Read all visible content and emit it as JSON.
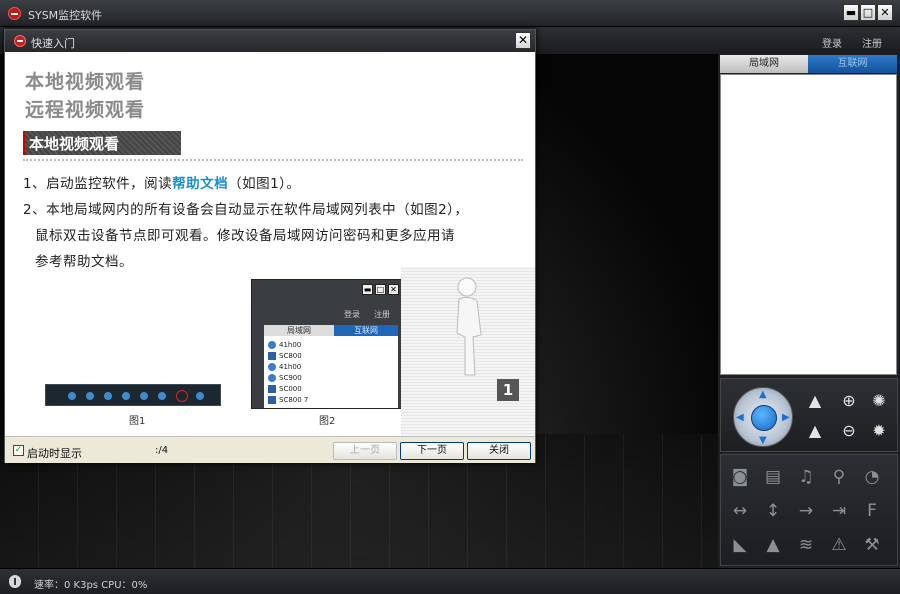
{
  "app": {
    "title": "SYSM监控软件"
  },
  "window_buttons": {
    "minimize": "▬",
    "maximize": "□",
    "close": "✕"
  },
  "top_links": {
    "login": "登录",
    "register": "注册"
  },
  "dialog": {
    "title": "快速入门",
    "close": "✕",
    "headings": [
      "本地视频观看",
      "远程视频观看"
    ],
    "section_title": "本地视频观看",
    "step1": {
      "prefix": "1、启动监控软件，阅读",
      "link": "帮助文档",
      "suffix": "（如图1）。"
    },
    "step2_line1": "2、本地局域网内的所有设备会自动显示在软件局域网列表中（如图2），",
    "step2_line2": "鼠标双击设备节点即可观看。修改设备局域网访问密码和更多应用请",
    "step2_line3": "参考帮助文档。",
    "fig1_caption": "图1",
    "fig2_caption": "图2",
    "fig2": {
      "login": "登录",
      "register": "注册",
      "tab_lan": "局域网",
      "tab_wan": "互联网",
      "items": [
        "41h00",
        "SC800",
        "41h00",
        "SC900",
        "SC000",
        "SC800 7"
      ]
    },
    "page_badge": "1",
    "footer": {
      "show_on_start": "启动时显示",
      "checked": "✓",
      "page_indicator": ":/4",
      "prev": "上一页",
      "next": "下一页",
      "close": "关闭"
    }
  },
  "right_panel": {
    "tabs": [
      "局域网",
      "互联网"
    ]
  },
  "status": {
    "text": "速率：0 K3ps  CPU：0%"
  }
}
